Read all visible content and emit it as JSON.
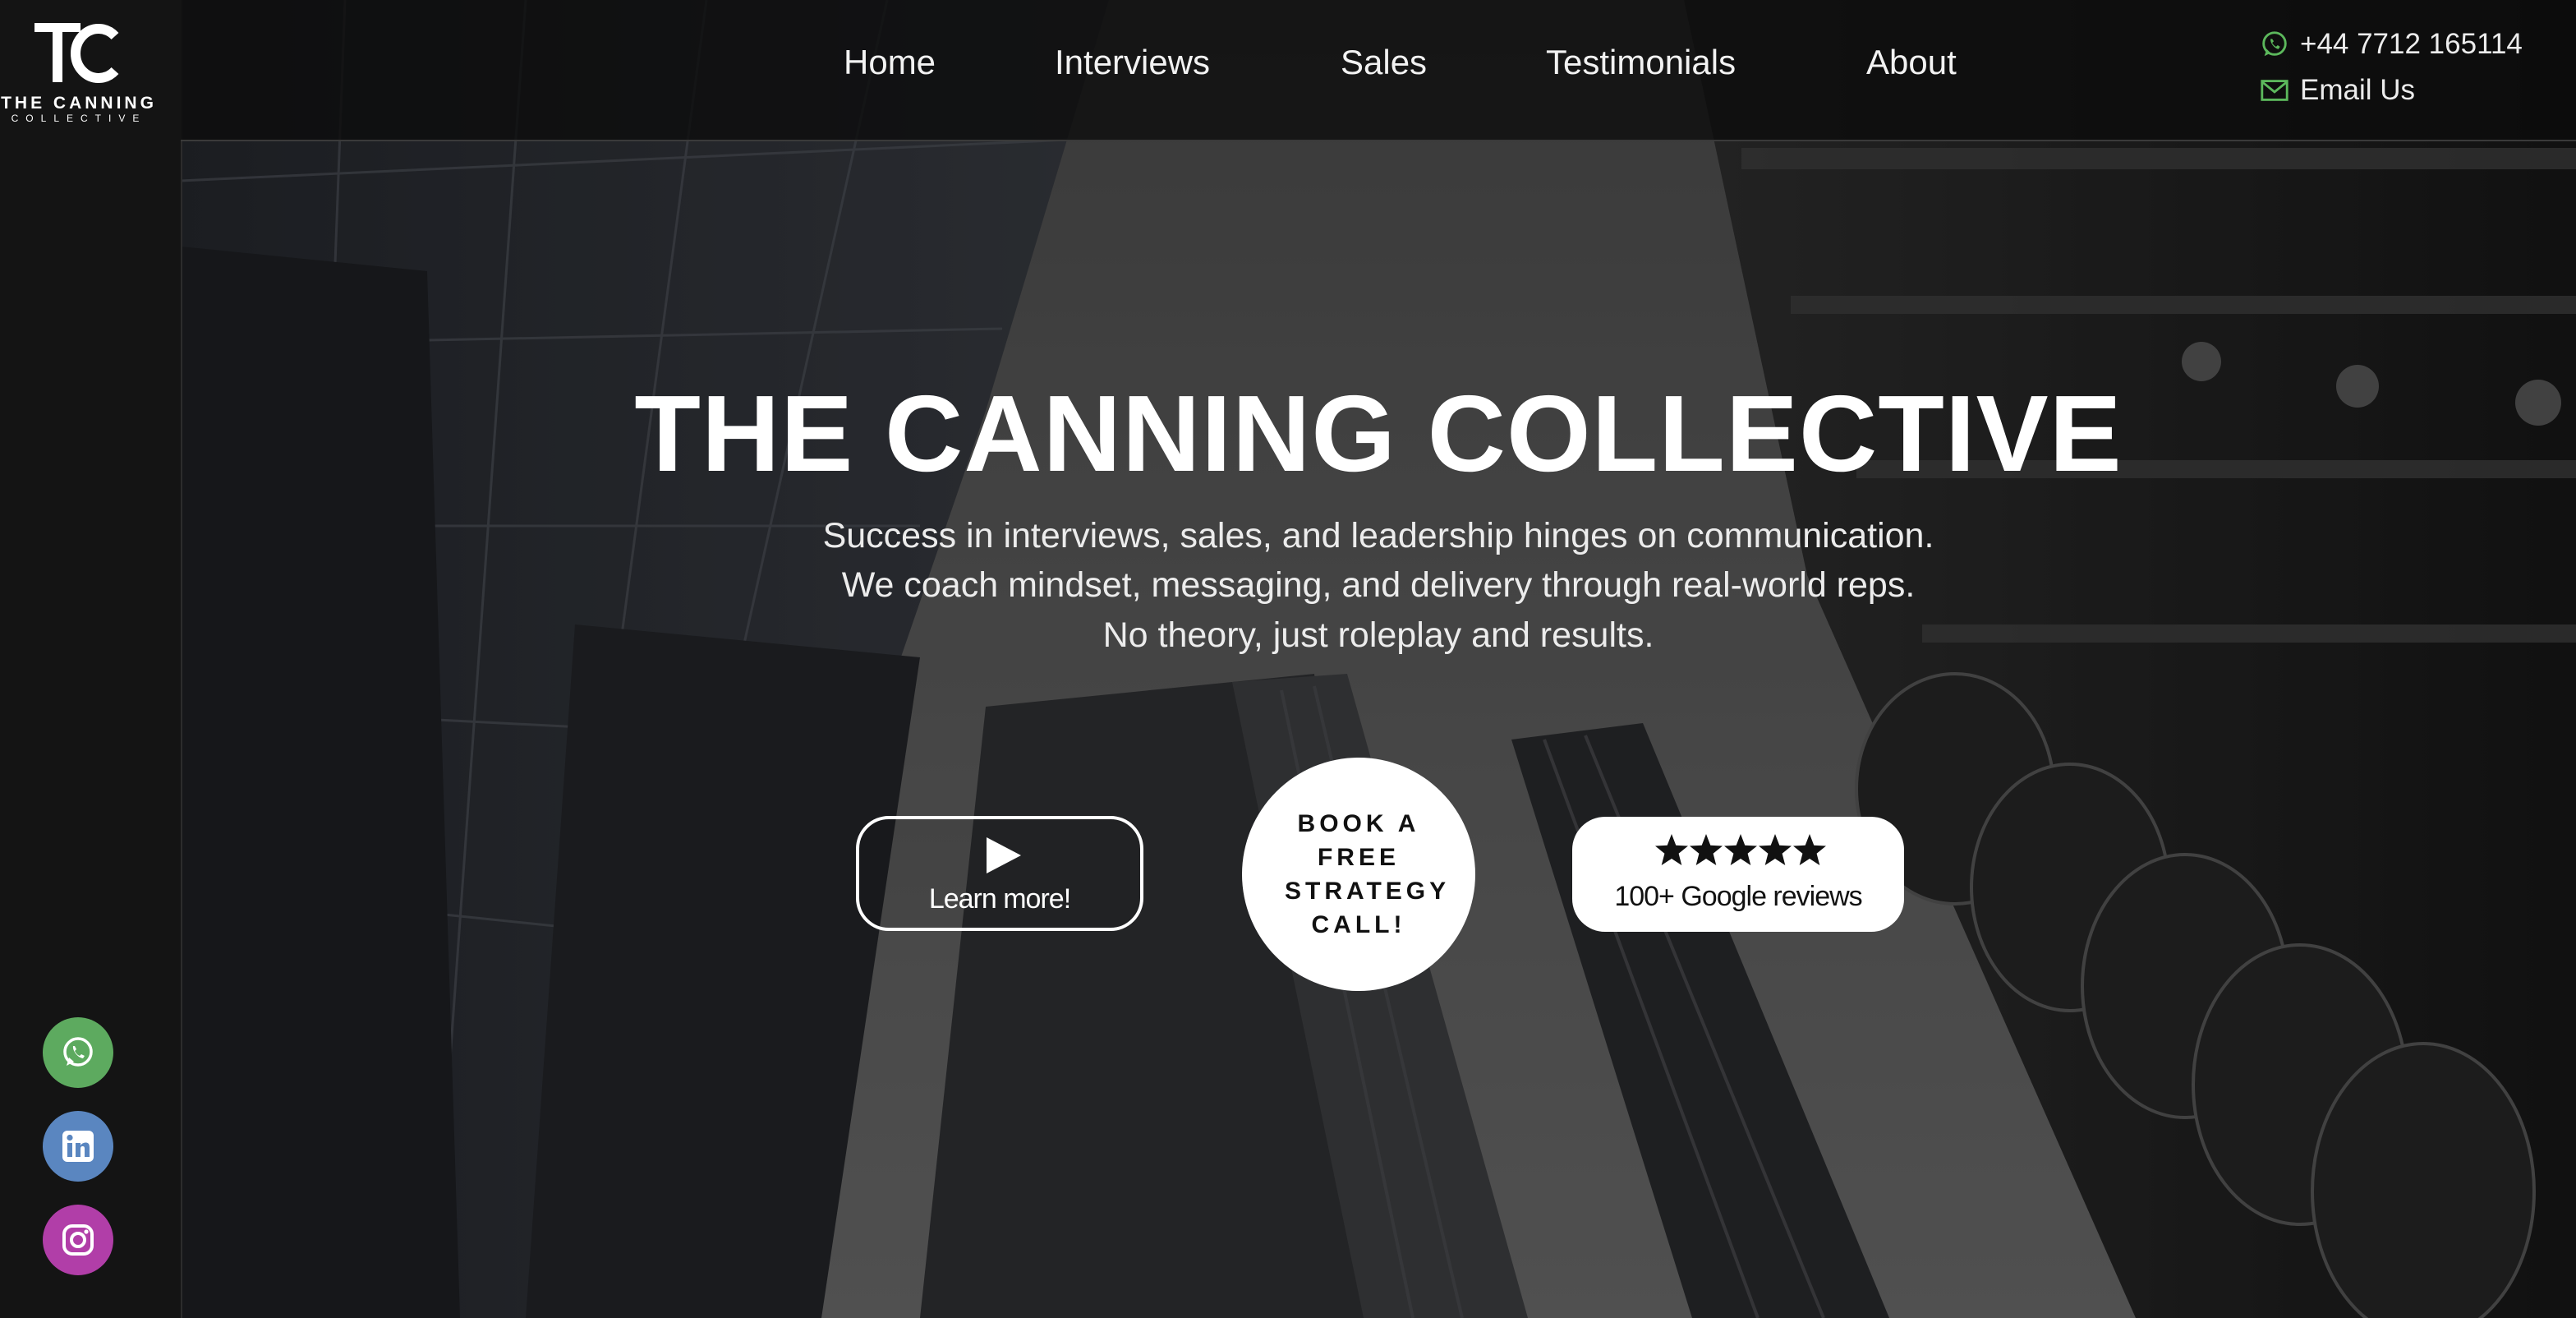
{
  "brand": {
    "logo_letters": "TC",
    "name_line1": "THE CANNING",
    "name_line2": "COLLECTIVE"
  },
  "nav": {
    "items": [
      {
        "label": "Home"
      },
      {
        "label": "Interviews"
      },
      {
        "label": "Sales"
      },
      {
        "label": "Testimonials"
      },
      {
        "label": "About"
      }
    ]
  },
  "contact": {
    "phone": "+44 7712 165114",
    "phone_icon": "whatsapp-icon",
    "email_label": "Email Us",
    "email_icon": "mail-icon",
    "icon_color": "#5cb85c"
  },
  "hero": {
    "title": "THE CANNING COLLECTIVE",
    "subtitle_lines": [
      "Success in interviews, sales, and leadership hinges on communication.",
      "We coach mindset, messaging, and delivery through real-world reps.",
      "No theory, just roleplay and results."
    ],
    "learn_more_label": "Learn more!",
    "learn_more_icon": "play-icon",
    "cta_label": "BOOK A FREE STRATEGY CALL!",
    "reviews": {
      "stars": 5,
      "label": "100+ Google reviews"
    }
  },
  "social": [
    {
      "name": "whatsapp",
      "icon": "whatsapp-icon",
      "color": "#5daa5f"
    },
    {
      "name": "linkedin",
      "icon": "linkedin-icon",
      "color": "#5a86c0"
    },
    {
      "name": "instagram",
      "icon": "instagram-icon",
      "color": "#b13ea8"
    }
  ]
}
